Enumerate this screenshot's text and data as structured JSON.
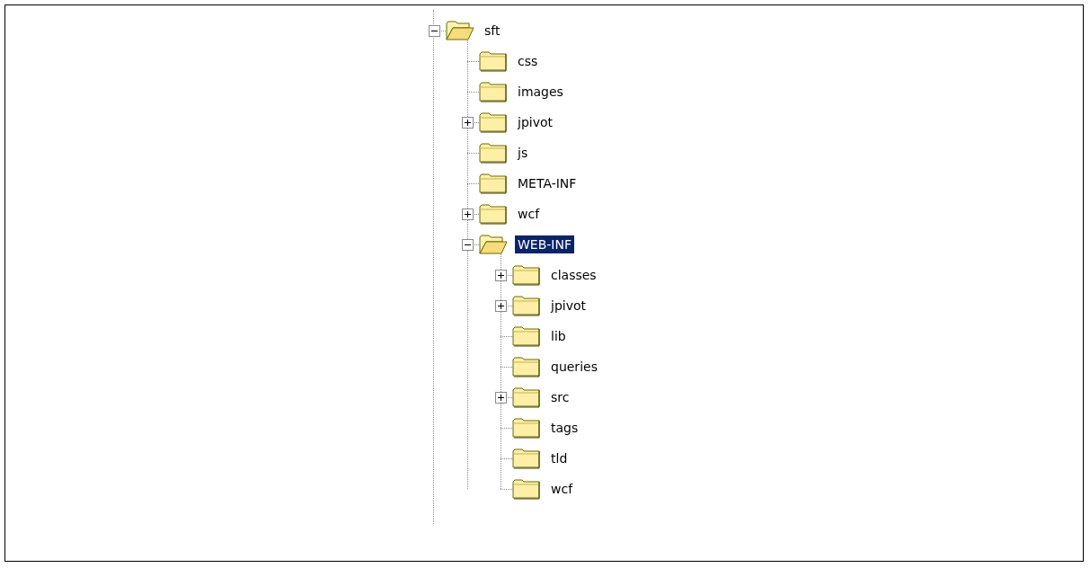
{
  "tree": [
    {
      "label": "sft",
      "expanded": true,
      "selected": false,
      "children": [
        {
          "label": "css",
          "selected": false
        },
        {
          "label": "images",
          "selected": false
        },
        {
          "label": "jpivot",
          "expanded": false,
          "selected": false
        },
        {
          "label": "js",
          "selected": false
        },
        {
          "label": "META-INF",
          "selected": false
        },
        {
          "label": "wcf",
          "expanded": false,
          "selected": false
        },
        {
          "label": "WEB-INF",
          "expanded": true,
          "selected": true,
          "children": [
            {
              "label": "classes",
              "expanded": false,
              "selected": false
            },
            {
              "label": "jpivot",
              "expanded": false,
              "selected": false
            },
            {
              "label": "lib",
              "selected": false
            },
            {
              "label": "queries",
              "selected": false
            },
            {
              "label": "src",
              "expanded": false,
              "selected": false
            },
            {
              "label": "tags",
              "selected": false
            },
            {
              "label": "tld",
              "selected": false
            },
            {
              "label": "wcf",
              "selected": false
            }
          ]
        }
      ]
    }
  ]
}
